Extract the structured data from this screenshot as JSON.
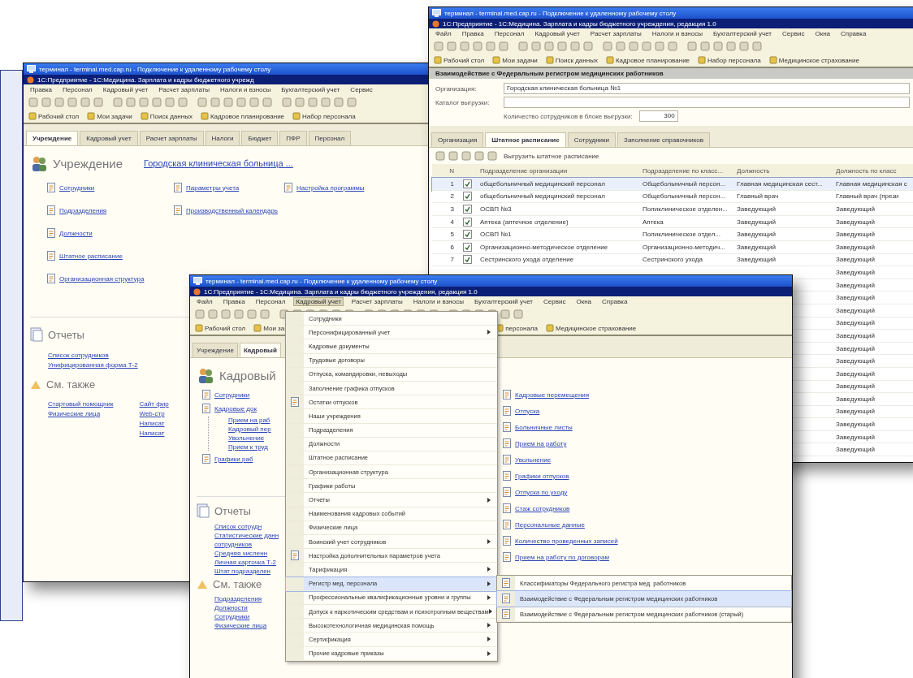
{
  "windows": [
    {
      "kind": "home",
      "title": "терминал - terminal.med.cap.ru - Подключение к удаленному рабочему столу",
      "subtitle": "1С:Предприятие - 1С:Медицина. Зарплата и кадры бюджетного учрежд",
      "menu": [
        {
          "label": "Правка",
          "selected": false
        },
        {
          "label": "Персонал",
          "selected": false
        },
        {
          "label": "Кадровый учет",
          "selected": false
        },
        {
          "label": "Расчет зарплаты",
          "selected": false
        },
        {
          "label": "Налоги и взносы",
          "selected": false
        },
        {
          "label": "Бухгалтерский учет",
          "selected": false
        },
        {
          "label": "Сервис",
          "selected": false
        }
      ],
      "shortcuts": [
        "Рабочий стол",
        "Мои задачи",
        "Поиск данных",
        "Кадровое планирование",
        "Набор персонала"
      ],
      "tabs": [
        {
          "label": "Учреждение",
          "selected": true
        },
        {
          "label": "Кадровый учет",
          "selected": false
        },
        {
          "label": "Расчет зарплаты",
          "selected": false
        },
        {
          "label": "Налоги",
          "selected": false
        },
        {
          "label": "Бюджет",
          "selected": false
        },
        {
          "label": "ПФР",
          "selected": false
        },
        {
          "label": "Персонал",
          "selected": false
        }
      ],
      "heading": "Учреждение",
      "org_link": "Городская клиническая больница ...",
      "link_columns": [
        [
          {
            "text": "Сотрудники"
          },
          {
            "text": "Подразделения"
          },
          {
            "text": "Должности"
          },
          {
            "text": "Штатное расписание"
          },
          {
            "text": "Организационная структура"
          }
        ],
        [
          {
            "text": "Параметры учета"
          },
          {
            "text": "Производственный календарь"
          }
        ],
        [
          {
            "text": "Настройка программы"
          }
        ]
      ],
      "reports": {
        "heading": "Отчеты",
        "links": [
          "Список сотрудников",
          "Унифицированная форма Т-2"
        ]
      },
      "see_also": {
        "heading": "См. также",
        "columns": [
          [
            "Стартовый помощник",
            "Физические лица"
          ],
          [
            "Сайт фир",
            "Web-стр",
            "Написат",
            "Написат"
          ]
        ]
      }
    },
    {
      "kind": "form",
      "title": "терминал - terminal.med.cap.ru - Подключение к удаленному рабочему столу",
      "subtitle": "1С:Предприятие - 1С:Медицина. Зарплата и кадры бюджетного учреждения, редакция 1.0",
      "menu": [
        {
          "label": "Файл",
          "selected": false
        },
        {
          "label": "Правка",
          "selected": false
        },
        {
          "label": "Персонал",
          "selected": false
        },
        {
          "label": "Кадровый учет",
          "selected": false
        },
        {
          "label": "Расчет зарплаты",
          "selected": false
        },
        {
          "label": "Налоги и взносы",
          "selected": false
        },
        {
          "label": "Бухгалтерский учет",
          "selected": false
        },
        {
          "label": "Сервис",
          "selected": false
        },
        {
          "label": "Окна",
          "selected": false
        },
        {
          "label": "Справка",
          "selected": false
        }
      ],
      "shortcuts": [
        "Рабочий стол",
        "Мои задачи",
        "Поиск данных",
        "Кадровое планирование",
        "Набор персонала",
        "Медицинское страхование"
      ],
      "form_title": "Взаимодействие с Федеральным регистром медицинских работников",
      "fields": [
        {
          "label": "Организация:",
          "value": "Городская клиническая больница №1"
        },
        {
          "label": "Каталог выгрузки:"
        }
      ],
      "count": {
        "label": "Количество сотрудников в блоке выгрузки:",
        "value": "300"
      },
      "tabs": [
        {
          "label": "Организация",
          "selected": false
        },
        {
          "label": "Штатное расписание",
          "selected": true
        },
        {
          "label": "Сотрудники",
          "selected": false
        },
        {
          "label": "Заполнение справочников",
          "selected": false
        }
      ],
      "action": "Выгрузить штатное расписание",
      "columns": [
        "N",
        "Подразделение организации",
        "Подразделение по класс...",
        "Должность",
        "Должность по класс"
      ],
      "rows": [
        {
          "number": "1",
          "checked": true,
          "selected": true,
          "cells": [
            "общебольничный медицинский персонал",
            "Общебольничный персон...",
            "Главная медицинская сест...",
            "Главная медицинская с"
          ]
        },
        {
          "number": "2",
          "checked": true,
          "selected": false,
          "cells": [
            "общебольничный медицинский персонал",
            "Общебольничный персон...",
            "Главный врач",
            "Главный врач (прези"
          ]
        },
        {
          "number": "3",
          "checked": true,
          "selected": false,
          "cells": [
            "ОСВП №3",
            "Поликлиническое отделен...",
            "Заведующий",
            "Заведующий"
          ]
        },
        {
          "number": "4",
          "checked": true,
          "selected": false,
          "cells": [
            "Аптека (аптечное отделение)",
            "Аптека",
            "Заведующий",
            "Заведующий"
          ]
        },
        {
          "number": "5",
          "checked": true,
          "selected": false,
          "cells": [
            "ОСВП №1",
            "Поликлиническое отдел...",
            "Заведующий",
            "Заведующий"
          ]
        },
        {
          "number": "6",
          "checked": true,
          "selected": false,
          "cells": [
            "Организационно-методическое отделение",
            "Организационно-методич...",
            "Заведующий",
            "Заведующий"
          ]
        },
        {
          "number": "7",
          "checked": true,
          "selected": false,
          "cells": [
            "Сестринского ухода отделение",
            "Сестринского ухода",
            "Заведующий",
            "Заведующий"
          ]
        },
        {
          "last": "Заведующий"
        },
        {
          "last": "Заведующий"
        },
        {
          "last": "Заведующий"
        },
        {
          "last": "Заведующий"
        },
        {
          "last": "Заведующий"
        },
        {
          "last": "Заведующий"
        },
        {
          "last": "Заведующий"
        },
        {
          "last": "Заведующий"
        },
        {
          "last": "Заведующий"
        },
        {
          "last": "Заведующий"
        },
        {
          "last": "Заведующий"
        },
        {
          "last": "Заведующий"
        },
        {
          "last": "Заведующий"
        },
        {
          "last": "Заведующий"
        },
        {
          "last": "Заведующий"
        }
      ]
    },
    {
      "kind": "home",
      "title": "терминал - terminal.med.cap.ru - Подключение к удаленному рабочему столу",
      "subtitle": "1С:Предприятие - 1С:Медицина. Зарплата и кадры бюджетного учреждения, редакция 1.0",
      "menu": [
        {
          "label": "Файл",
          "selected": false
        },
        {
          "label": "Правка",
          "selected": false
        },
        {
          "label": "Персонал",
          "selected": false
        },
        {
          "label": "Кадровый учет",
          "selected": true
        },
        {
          "label": "Расчет зарплаты",
          "selected": false
        },
        {
          "label": "Налоги и взносы",
          "selected": false
        },
        {
          "label": "Бухгалтерский учет",
          "selected": false
        },
        {
          "label": "Сервис",
          "selected": false
        },
        {
          "label": "Окна",
          "selected": false
        },
        {
          "label": "Справка",
          "selected": false
        }
      ],
      "shortcuts": [
        "Рабочий стол",
        "Мои за",
        "персонала",
        "Медицинское страхование"
      ],
      "tabs": [
        {
          "label": "Учреждение",
          "selected": false
        },
        {
          "label": "Кадровый",
          "selected": true
        }
      ],
      "heading": "Кадровый",
      "link_columns": [
        [
          {
            "text": "Сотрудники"
          },
          {
            "text": "Кадровые док",
            "children": [
              "Прием на раб",
              "Кадровый пер",
              "Увольнение",
              "Прием к труд"
            ]
          },
          {
            "text": "Графики раб"
          }
        ],
        [
          {
            "text": "Кадровые перемещения"
          },
          {
            "text": "Отпуска"
          },
          {
            "text": "Больничные листы"
          },
          {
            "text": "Прием на работу"
          },
          {
            "text": "Увольнение"
          },
          {
            "text": "Графики отпусков"
          },
          {
            "text": "Отпуска по уходу"
          },
          {
            "text": "Стаж сотрудников"
          },
          {
            "text": "Персональные данные"
          },
          {
            "text": "Количество проведенных записей"
          },
          {
            "text": "Прием на работу по договорам"
          }
        ]
      ],
      "reports": {
        "heading": "Отчеты",
        "links": [
          "Список сотрудн",
          "Статистические данн",
          "сотрудников",
          "Средняя численн",
          "Личная карточка Т-2",
          "Штат подразделен"
        ]
      },
      "see_also": {
        "heading": "См. также",
        "columns": [
          [
            "Подразделения",
            "Должности",
            "Сотрудники",
            "Физические лица"
          ]
        ]
      },
      "dropdown": [
        {
          "text": "Сотрудники",
          "has_submenu": false,
          "selected": false
        },
        {
          "text": "Персонифицированный учет",
          "has_submenu": true,
          "selected": false
        },
        {
          "text": "Кадровые документы",
          "has_submenu": false,
          "selected": false
        },
        {
          "text": "Трудовые договоры",
          "has_submenu": false,
          "selected": false
        },
        {
          "text": "Отпуска, командировки, невыходы",
          "has_submenu": false,
          "selected": false
        },
        {
          "text": "Заполнение графика отпусков",
          "has_submenu": false,
          "selected": false
        },
        {
          "text": "Остатки отпусков",
          "has_submenu": false,
          "selected": false,
          "icon": true
        },
        {
          "text": "Наши учреждения",
          "has_submenu": false,
          "selected": false
        },
        {
          "text": "Подразделения",
          "has_submenu": false,
          "selected": false
        },
        {
          "text": "Должности",
          "has_submenu": false,
          "selected": false
        },
        {
          "text": "Штатное расписание",
          "has_submenu": false,
          "selected": false
        },
        {
          "text": "Организационная структура",
          "has_submenu": false,
          "selected": false
        },
        {
          "text": "Графики работы",
          "has_submenu": false,
          "selected": false
        },
        {
          "text": "Отчеты",
          "has_submenu": true,
          "selected": false
        },
        {
          "text": "Наименования кадровых событий",
          "has_submenu": false,
          "selected": false
        },
        {
          "text": "Физические лица",
          "has_submenu": false,
          "selected": false
        },
        {
          "text": "Воинский учет сотрудников",
          "has_submenu": true,
          "selected": false
        },
        {
          "text": "Настройка дополнительных параметров учета",
          "has_submenu": false,
          "selected": false,
          "icon": true
        },
        {
          "text": "Тарификация",
          "has_submenu": true,
          "selected": false
        },
        {
          "text": "Регистр мед. персонала",
          "has_submenu": true,
          "selected": true
        },
        {
          "text": "Профессиональные квалификационные уровни и группы",
          "has_submenu": true,
          "selected": false
        },
        {
          "text": "Допуск к наркотическим средствам и психотропным веществам",
          "has_submenu": true,
          "selected": false
        },
        {
          "text": "Высокотехнологичная медицинская помощь",
          "has_submenu": true,
          "selected": false
        },
        {
          "text": "Сертификация",
          "has_submenu": true,
          "selected": false
        },
        {
          "text": "Прочие кадровые приказы",
          "has_submenu": true,
          "selected": false
        }
      ],
      "submenu": [
        {
          "text": "Классификаторы Федерального регистра мед. работников",
          "selected": false
        },
        {
          "text": "Взаимодействие с Федеральным регистром медицинских работников",
          "selected": true
        },
        {
          "text": "Взаимодействие с Федеральным регистром медицинских работников (старый)",
          "selected": false
        }
      ]
    }
  ]
}
